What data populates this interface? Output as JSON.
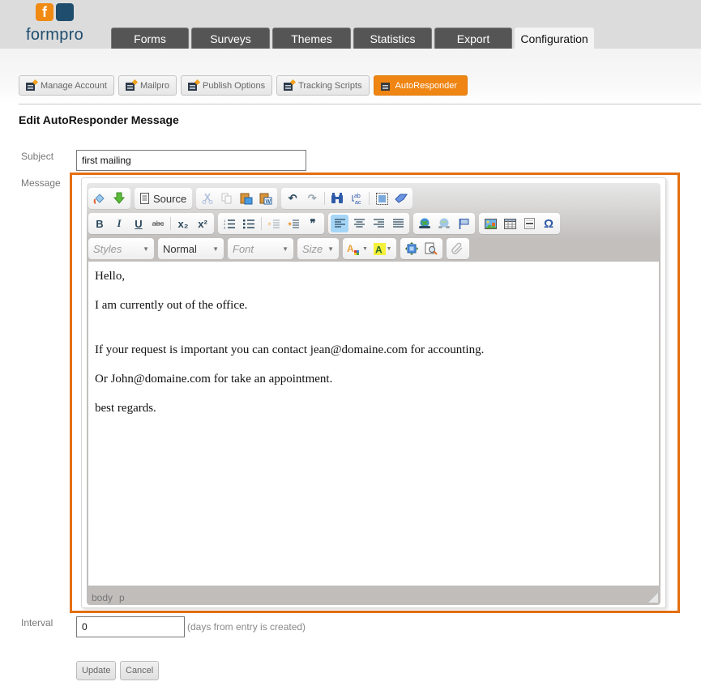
{
  "brand": {
    "name": "formpro",
    "logo_letter": "f",
    "colors": {
      "orange": "#f08a13",
      "navy": "#1e4d6e",
      "frame": "#e46f10"
    }
  },
  "nav": {
    "tabs": [
      {
        "label": "Forms",
        "active": false
      },
      {
        "label": "Surveys",
        "active": false
      },
      {
        "label": "Themes",
        "active": false
      },
      {
        "label": "Statistics",
        "active": false
      },
      {
        "label": "Export",
        "active": false
      },
      {
        "label": "Configuration",
        "active": true
      }
    ]
  },
  "subnav": {
    "tabs": [
      {
        "label": "Manage Account",
        "active": false
      },
      {
        "label": "Mailpro",
        "active": false
      },
      {
        "label": "Publish Options",
        "active": false
      },
      {
        "label": "Tracking Scripts",
        "active": false
      },
      {
        "label": "AutoResponder",
        "active": true
      }
    ]
  },
  "page": {
    "title": "Edit AutoResponder Message"
  },
  "form": {
    "subject_label": "Subject",
    "subject_value": "first mailing",
    "message_label": "Message",
    "interval_label": "Interval",
    "interval_value": "0",
    "interval_hint": "(days from entry is created)",
    "update_label": "Update",
    "cancel_label": "Cancel"
  },
  "editor": {
    "toolbar": {
      "source_label": "Source",
      "styles_placeholder": "Styles",
      "format_value": "Normal",
      "font_placeholder": "Font",
      "size_placeholder": "Size",
      "icons": {
        "row1": [
          "paint-bucket-icon",
          "download-arrow-icon",
          "source-icon",
          "cut-icon",
          "copy-icon",
          "paste-icon",
          "paste-word-icon",
          "undo-icon",
          "redo-icon",
          "find-icon",
          "replace-icon",
          "select-all-icon",
          "remove-format-icon"
        ],
        "row2": [
          "bold-icon",
          "italic-icon",
          "underline-icon",
          "strikethrough-icon",
          "subscript-icon",
          "superscript-icon",
          "numbered-list-icon",
          "bulleted-list-icon",
          "outdent-icon",
          "indent-icon",
          "blockquote-icon",
          "align-left-icon",
          "align-center-icon",
          "align-right-icon",
          "justify-icon",
          "link-icon",
          "unlink-icon",
          "anchor-icon",
          "image-icon",
          "table-icon",
          "horizontal-rule-icon",
          "special-char-icon"
        ],
        "row3": [
          "text-color-icon",
          "background-color-icon",
          "maximize-icon",
          "preview-icon",
          "attachment-icon"
        ]
      },
      "glyphs": {
        "bold": "B",
        "italic": "I",
        "underline": "U",
        "strike": "abc",
        "sub": "x₂",
        "sup": "x²",
        "blockquote": "❞",
        "omega": "Ω",
        "undo": "↶",
        "redo": "↷",
        "caret": "▼"
      }
    },
    "content": [
      "Hello,",
      "I am currently out of the office.",
      "If your request is important you can contact jean@domaine.com for accounting.",
      "Or John@domaine.com for take an appointment.",
      "best regards."
    ],
    "statusbar": [
      "body",
      "p"
    ]
  }
}
